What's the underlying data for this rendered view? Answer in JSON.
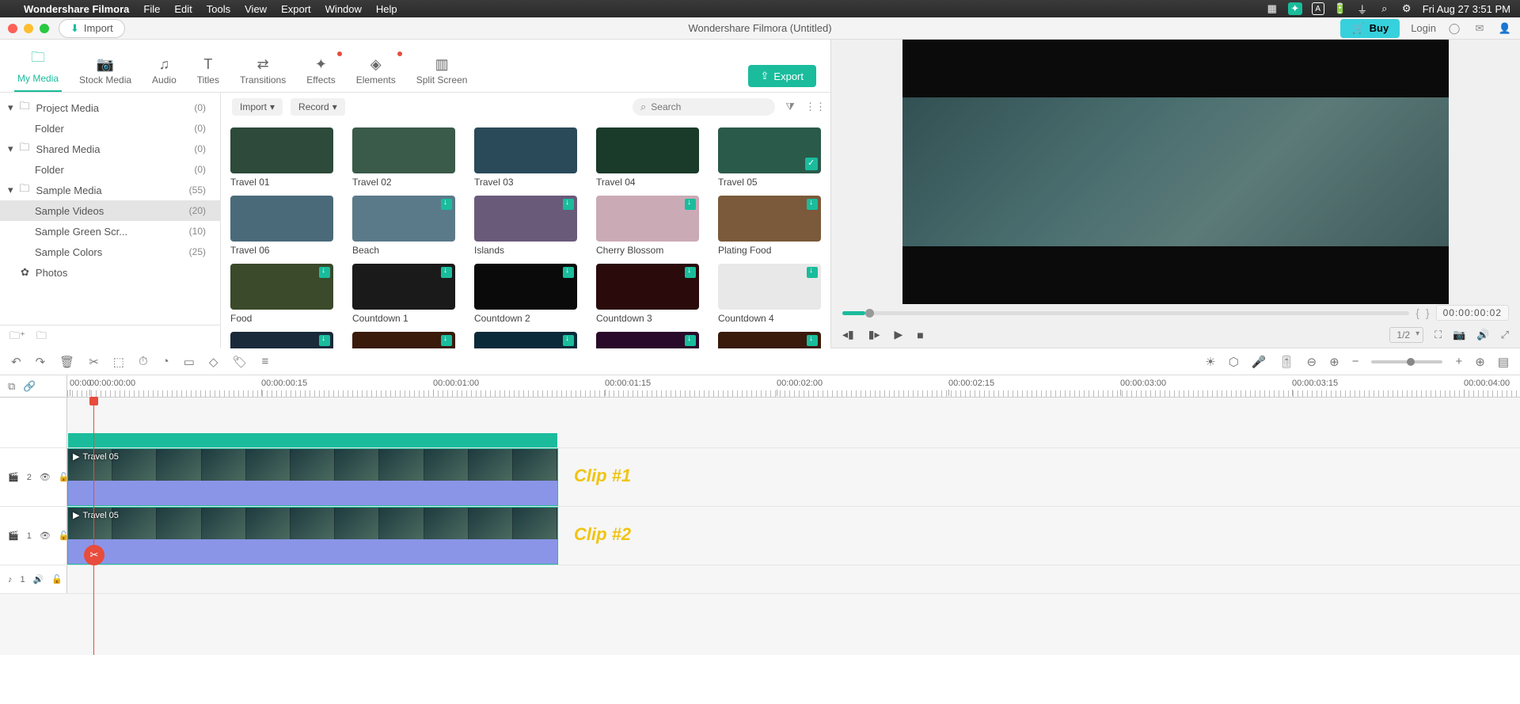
{
  "menubar": {
    "app_name": "Wondershare Filmora",
    "items": [
      "File",
      "Edit",
      "Tools",
      "View",
      "Export",
      "Window",
      "Help"
    ],
    "clock": "Fri Aug 27  3:51 PM"
  },
  "titlebar": {
    "import_label": "Import",
    "title": "Wondershare Filmora (Untitled)",
    "buy_label": "Buy",
    "login_label": "Login"
  },
  "tabs": {
    "items": [
      "My Media",
      "Stock Media",
      "Audio",
      "Titles",
      "Transitions",
      "Effects",
      "Elements",
      "Split Screen"
    ],
    "export_label": "Export"
  },
  "sidebar": {
    "project_media": "Project Media",
    "project_count": "(0)",
    "folder1": "Folder",
    "folder1_count": "(0)",
    "shared_media": "Shared Media",
    "shared_count": "(0)",
    "folder2": "Folder",
    "folder2_count": "(0)",
    "sample_media": "Sample Media",
    "sample_count": "(55)",
    "sample_videos": "Sample Videos",
    "sample_videos_count": "(20)",
    "sample_green": "Sample Green Scr...",
    "sample_green_count": "(10)",
    "sample_colors": "Sample Colors",
    "sample_colors_count": "(25)",
    "photos": "Photos"
  },
  "browser": {
    "import_dd": "Import",
    "record_dd": "Record",
    "search_placeholder": "Search",
    "clips": [
      {
        "name": "Travel 01",
        "dl": false,
        "check": false,
        "bg": "#2d4a3a"
      },
      {
        "name": "Travel 02",
        "dl": false,
        "check": false,
        "bg": "#3a5a4a"
      },
      {
        "name": "Travel 03",
        "dl": false,
        "check": false,
        "bg": "#2a4a5a"
      },
      {
        "name": "Travel 04",
        "dl": false,
        "check": false,
        "bg": "#1a3a2a"
      },
      {
        "name": "Travel 05",
        "dl": false,
        "check": true,
        "bg": "#2a5a4a"
      },
      {
        "name": "Travel 06",
        "dl": false,
        "check": false,
        "bg": "#4a6a7a"
      },
      {
        "name": "Beach",
        "dl": true,
        "check": false,
        "bg": "#5a7a8a"
      },
      {
        "name": "Islands",
        "dl": true,
        "check": false,
        "bg": "#6a5a7a"
      },
      {
        "name": "Cherry Blossom",
        "dl": true,
        "check": false,
        "bg": "#caaab5"
      },
      {
        "name": "Plating Food",
        "dl": true,
        "check": false,
        "bg": "#7a5a3a"
      },
      {
        "name": "Food",
        "dl": true,
        "check": false,
        "bg": "#3a4a2a"
      },
      {
        "name": "Countdown 1",
        "dl": true,
        "check": false,
        "bg": "#1a1a1a"
      },
      {
        "name": "Countdown 2",
        "dl": true,
        "check": false,
        "bg": "#0a0a0a"
      },
      {
        "name": "Countdown 3",
        "dl": true,
        "check": false,
        "bg": "#2a0a0a"
      },
      {
        "name": "Countdown 4",
        "dl": true,
        "check": false,
        "bg": "#e8e8e8"
      },
      {
        "name": "",
        "dl": true,
        "check": false,
        "bg": "#1a2a3a"
      },
      {
        "name": "",
        "dl": true,
        "check": false,
        "bg": "#3a1a0a"
      },
      {
        "name": "",
        "dl": true,
        "check": false,
        "bg": "#0a2a3a"
      },
      {
        "name": "",
        "dl": true,
        "check": false,
        "bg": "#2a0a2a"
      },
      {
        "name": "",
        "dl": true,
        "check": false,
        "bg": "#3a1a0a"
      }
    ]
  },
  "preview": {
    "timecode": "00:00:00:02",
    "ratio": "1/2"
  },
  "ruler": {
    "labels": [
      "00:00:00:00",
      "00:00:00:15",
      "00:00:01:00",
      "00:00:01:15",
      "00:00:02:00",
      "00:00:02:15",
      "00:00:03:00",
      "00:00:03:15",
      "00:00:04:00"
    ],
    "mini": "00:00"
  },
  "tracks": {
    "v2": "2",
    "v1": "1",
    "a1": "1",
    "clip_name": "Travel 05",
    "label1": "Clip #1",
    "label2": "Clip #2"
  }
}
